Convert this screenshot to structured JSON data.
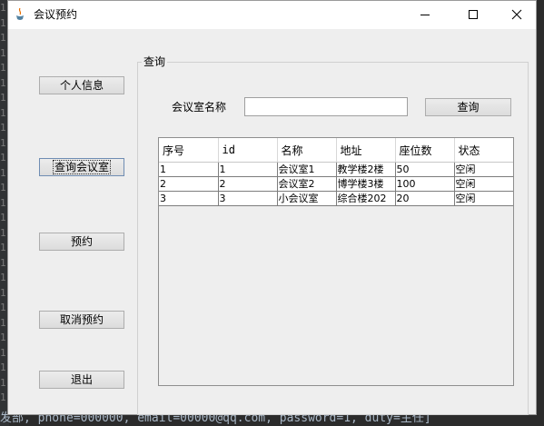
{
  "background": {
    "gutter_lines": [
      "1",
      "1",
      "1",
      "1",
      "1",
      "1",
      "1",
      "1",
      "1",
      "1",
      "1",
      "1",
      "1",
      "1",
      "1",
      "1",
      "1",
      "1",
      "1",
      "1",
      "1",
      "1",
      "1",
      "1",
      "1",
      "1",
      "1"
    ],
    "console_text": "发部, phone=000000, email=00000@qq.com, password=1, duty=主任]"
  },
  "window": {
    "title": "会议预约",
    "controls": {
      "minimize": "minimize",
      "maximize": "maximize",
      "close": "close"
    }
  },
  "sidebar": {
    "items": [
      {
        "label": "个人信息"
      },
      {
        "label": "查询会议室"
      },
      {
        "label": "预约"
      },
      {
        "label": "取消预约"
      },
      {
        "label": "退出"
      }
    ]
  },
  "query_panel": {
    "group_title": "查询",
    "search_label": "会议室名称",
    "search_value": "",
    "search_button": "查询"
  },
  "table": {
    "columns": [
      "序号",
      "id",
      "名称",
      "地址",
      "座位数",
      "状态"
    ],
    "rows": [
      [
        "1",
        "1",
        "会议室1",
        "教学楼2楼",
        "50",
        "空闲"
      ],
      [
        "2",
        "2",
        "会议室2",
        "博学楼3楼",
        "100",
        "空闲"
      ],
      [
        "3",
        "3",
        "小会议室",
        "综合楼202",
        "20",
        "空闲"
      ]
    ]
  }
}
